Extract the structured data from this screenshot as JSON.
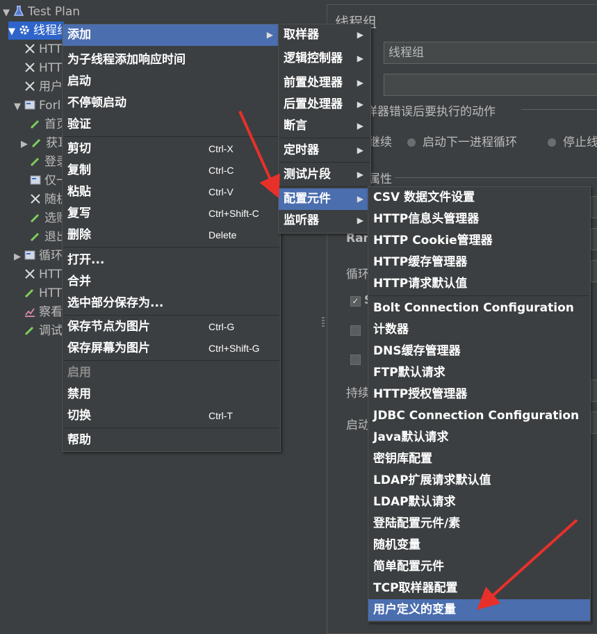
{
  "tree": {
    "items": [
      {
        "label": "Test Plan"
      },
      {
        "label": "线程组"
      },
      {
        "label": "HTT"
      },
      {
        "label": "HTT"
      },
      {
        "label": "用户"
      },
      {
        "label": "Forl"
      },
      {
        "label": "首页"
      },
      {
        "label": "获耳"
      },
      {
        "label": "登录"
      },
      {
        "label": "仅一"
      },
      {
        "label": "随机"
      },
      {
        "label": "选购"
      },
      {
        "label": "退出"
      },
      {
        "label": "循环"
      },
      {
        "label": "HTT"
      },
      {
        "label": "HTT"
      },
      {
        "label": "察看"
      },
      {
        "label": "调试"
      }
    ]
  },
  "panel": {
    "title": "线程组",
    "name_value": "线程组",
    "comment_value": "",
    "error_action_label": "样器错误后要执行的动作",
    "radio_continue": "继续",
    "radio_next_loop": "启动下一进程循环",
    "radio_stop": "停止线",
    "props_label": "属性",
    "ramp_label": "Ram",
    "loop_label": "循环",
    "chk1_label": "S",
    "duration_label": "持续",
    "delay_label": "启动"
  },
  "context_menu": {
    "items": [
      {
        "label": "添加",
        "shortcut": "",
        "submenu": true
      },
      {
        "label": "为子线程添加响应时间",
        "shortcut": ""
      },
      {
        "label": "启动",
        "shortcut": ""
      },
      {
        "label": "不停顿启动",
        "shortcut": ""
      },
      {
        "label": "验证",
        "shortcut": ""
      },
      {
        "label": "剪切",
        "shortcut": "Ctrl-X"
      },
      {
        "label": "复制",
        "shortcut": "Ctrl-C"
      },
      {
        "label": "粘贴",
        "shortcut": "Ctrl-V"
      },
      {
        "label": "复写",
        "shortcut": "Ctrl+Shift-C"
      },
      {
        "label": "删除",
        "shortcut": "Delete"
      },
      {
        "label": "打开...",
        "shortcut": ""
      },
      {
        "label": "合并",
        "shortcut": ""
      },
      {
        "label": "选中部分保存为...",
        "shortcut": ""
      },
      {
        "label": "保存节点为图片",
        "shortcut": "Ctrl-G"
      },
      {
        "label": "保存屏幕为图片",
        "shortcut": "Ctrl+Shift-G"
      },
      {
        "label": "启用",
        "shortcut": "",
        "disabled": true
      },
      {
        "label": "禁用",
        "shortcut": ""
      },
      {
        "label": "切换",
        "shortcut": "Ctrl-T"
      },
      {
        "label": "帮助",
        "shortcut": ""
      }
    ]
  },
  "add_submenu": {
    "items": [
      {
        "label": "取样器"
      },
      {
        "label": "逻辑控制器"
      },
      {
        "label": "前置处理器"
      },
      {
        "label": "后置处理器"
      },
      {
        "label": "断言"
      },
      {
        "label": "定时器"
      },
      {
        "label": "测试片段"
      },
      {
        "label": "配置元件"
      },
      {
        "label": "监听器"
      }
    ]
  },
  "config_submenu": {
    "items": [
      {
        "label": "CSV 数据文件设置"
      },
      {
        "label": "HTTP信息头管理器"
      },
      {
        "label": "HTTP Cookie管理器"
      },
      {
        "label": "HTTP缓存管理器"
      },
      {
        "label": "HTTP请求默认值"
      },
      {
        "label": "Bolt Connection Configuration"
      },
      {
        "label": "计数器"
      },
      {
        "label": "DNS缓存管理器"
      },
      {
        "label": "FTP默认请求"
      },
      {
        "label": "HTTP授权管理器"
      },
      {
        "label": "JDBC Connection Configuration"
      },
      {
        "label": "Java默认请求"
      },
      {
        "label": "密钥库配置"
      },
      {
        "label": "LDAP扩展请求默认值"
      },
      {
        "label": "LDAP默认请求"
      },
      {
        "label": "登陆配置元件/素"
      },
      {
        "label": "随机变量"
      },
      {
        "label": "简单配置元件"
      },
      {
        "label": "TCP取样器配置"
      },
      {
        "label": "用户定义的变量"
      }
    ]
  },
  "colors": {
    "background": "#3c3f41",
    "selection": "#4b6eaf",
    "tree_selection": "#2f65ca",
    "annotation_arrow": "#e8302a"
  }
}
